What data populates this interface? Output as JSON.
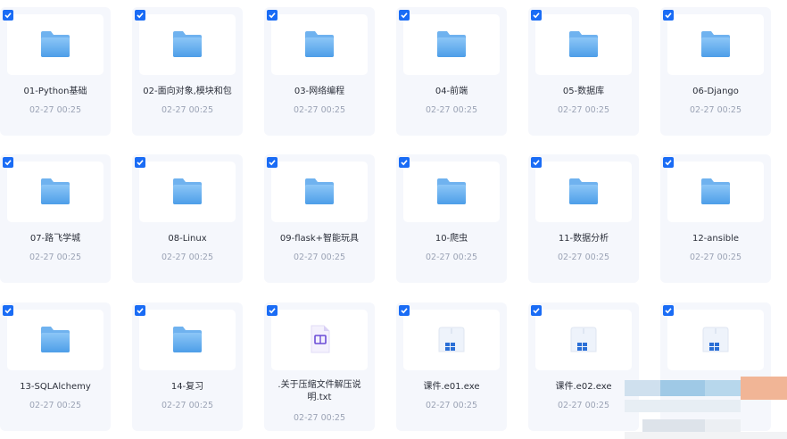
{
  "files": [
    {
      "name": "01-Python基础",
      "date": "02-27 00:25",
      "type": "folder",
      "icon": "folder-icon",
      "checked": true
    },
    {
      "name": "02-面向对象,模块和包",
      "date": "02-27 00:25",
      "type": "folder",
      "icon": "folder-icon",
      "checked": true
    },
    {
      "name": "03-网络编程",
      "date": "02-27 00:25",
      "type": "folder",
      "icon": "folder-icon",
      "checked": true
    },
    {
      "name": "04-前端",
      "date": "02-27 00:25",
      "type": "folder",
      "icon": "folder-icon",
      "checked": true
    },
    {
      "name": "05-数据库",
      "date": "02-27 00:25",
      "type": "folder",
      "icon": "folder-icon",
      "checked": true
    },
    {
      "name": "06-Django",
      "date": "02-27 00:25",
      "type": "folder",
      "icon": "folder-icon",
      "checked": true
    },
    {
      "name": "07-路飞学城",
      "date": "02-27 00:25",
      "type": "folder",
      "icon": "folder-icon",
      "checked": true
    },
    {
      "name": "08-Linux",
      "date": "02-27 00:25",
      "type": "folder",
      "icon": "folder-icon",
      "checked": true
    },
    {
      "name": "09-flask+智能玩具",
      "date": "02-27 00:25",
      "type": "folder",
      "icon": "folder-icon",
      "checked": true
    },
    {
      "name": "10-爬虫",
      "date": "02-27 00:25",
      "type": "folder",
      "icon": "folder-icon",
      "checked": true
    },
    {
      "name": "11-数据分析",
      "date": "02-27 00:25",
      "type": "folder",
      "icon": "folder-icon",
      "checked": true
    },
    {
      "name": "12-ansible",
      "date": "02-27 00:25",
      "type": "folder",
      "icon": "folder-icon",
      "checked": true
    },
    {
      "name": "13-SQLAlchemy",
      "date": "02-27 00:25",
      "type": "folder",
      "icon": "folder-icon",
      "checked": true
    },
    {
      "name": "14-复习",
      "date": "02-27 00:25",
      "type": "folder",
      "icon": "folder-icon",
      "checked": true
    },
    {
      "name": ".关于压缩文件解压说明.txt",
      "date": "02-27 00:25",
      "type": "txt",
      "icon": "text-document-icon",
      "checked": true
    },
    {
      "name": "课件.e01.exe",
      "date": "02-27 00:25",
      "type": "exe",
      "icon": "executable-icon",
      "checked": true
    },
    {
      "name": "课件.e02.exe",
      "date": "02-27 00:25",
      "type": "exe",
      "icon": "executable-icon",
      "checked": true
    },
    {
      "name": "",
      "date": "",
      "type": "exe",
      "icon": "executable-icon",
      "checked": true
    }
  ],
  "colors": {
    "checkbox": "#1a6cf5",
    "card_bg": "#f5f7fc",
    "folder_blue": "#5aa8f0",
    "txt_purple": "#6b4cd6",
    "date_gray": "#9ba3b5"
  }
}
